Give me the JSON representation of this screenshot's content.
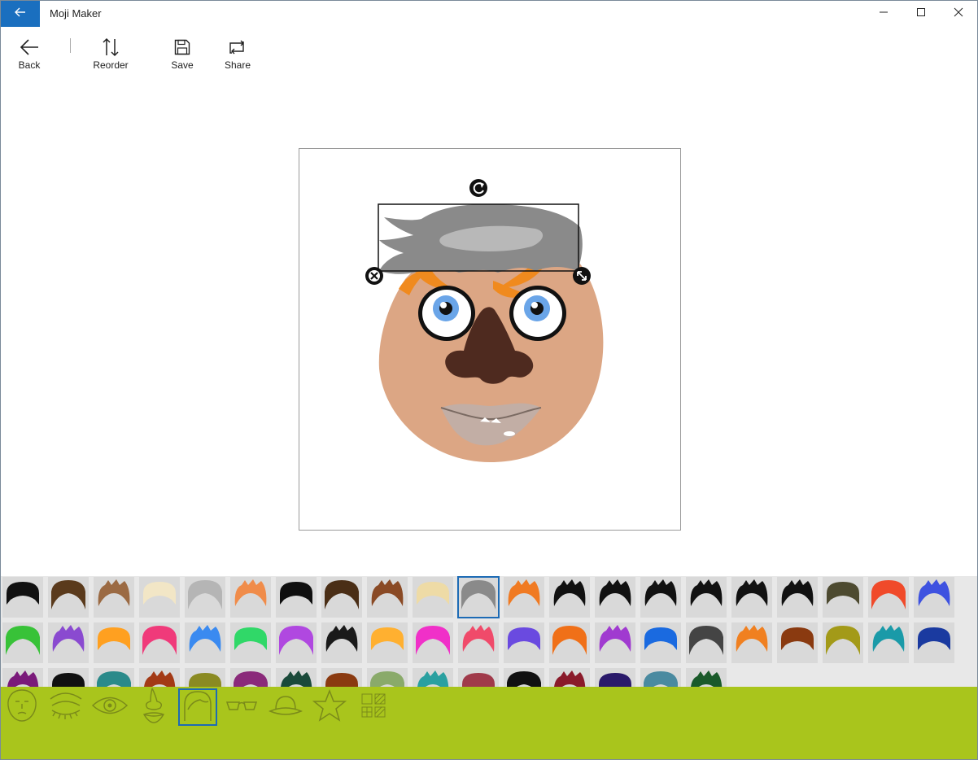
{
  "window": {
    "title": "Moji Maker"
  },
  "titlebar": {
    "back_icon": "arrow-left-icon",
    "minimize_icon": "minimize-icon",
    "maximize_icon": "maximize-icon",
    "close_icon": "close-icon"
  },
  "toolbar": {
    "back_label": "Back",
    "reorder_label": "Reorder",
    "save_label": "Save",
    "share_label": "Share"
  },
  "canvas": {
    "selected_part": "hair",
    "handles": [
      "rotate-handle-icon",
      "delete-handle-icon",
      "resize-handle-icon"
    ]
  },
  "colors": {
    "accent_blue": "#1a6fbf",
    "category_bar": "#a9c51c",
    "skin": "#dca684",
    "hair_selected": "#8a8a8a",
    "eyebrow": "#f08a1e",
    "nose": "#4e2a1f",
    "iris": "#6aa5e8"
  },
  "hair_rows": [
    [
      "#111111",
      "#5a3a1c",
      "#9b6a43",
      "#f2e6c6",
      "#b5b5b5",
      "#f08c4a",
      "#0f0f0f",
      "#4a2e16",
      "#8a4a25",
      "#eedba6",
      "#8a8a8a",
      "#f07a22",
      "#111111",
      "#111111",
      "#111111",
      "#111111",
      "#111111",
      "#111111",
      "#4d4a30",
      "#f04a2a",
      "#3e52e0"
    ],
    [
      "#38c238",
      "#8a4ad0",
      "#ffa020",
      "#f03a7a",
      "#3a8af0",
      "#30d868",
      "#b048e0",
      "#1a1a1a",
      "#ffb030",
      "#f030c8",
      "#f04a6a",
      "#6a4ae0",
      "#f07018",
      "#a03ad0",
      "#1a6ae0",
      "#444444",
      "#f08020",
      "#8a3a10",
      "#a39a18",
      "#1a9aa8",
      "#1a3aa0"
    ],
    [
      "#7a1a7a",
      "#111111",
      "#2a8a8a",
      "#a33a16",
      "#8a8a22",
      "#8a2a7a",
      "#1a4a3a",
      "#8a3a10",
      "#8aaa6a",
      "#2aa0a0",
      "#a03a4a",
      "#111111",
      "#8a1a2a",
      "#2a1a6a",
      "#4a8aa0",
      "#1a5a2a"
    ]
  ],
  "selected_hair_index": 10,
  "categories": [
    {
      "name": "face-shape-icon"
    },
    {
      "name": "eyebrows-icon"
    },
    {
      "name": "eye-icon"
    },
    {
      "name": "nose-mouth-icon"
    },
    {
      "name": "hair-icon"
    },
    {
      "name": "glasses-icon"
    },
    {
      "name": "hat-icon"
    },
    {
      "name": "star-icon"
    },
    {
      "name": "pattern-grid-icon"
    }
  ],
  "selected_category_index": 4
}
